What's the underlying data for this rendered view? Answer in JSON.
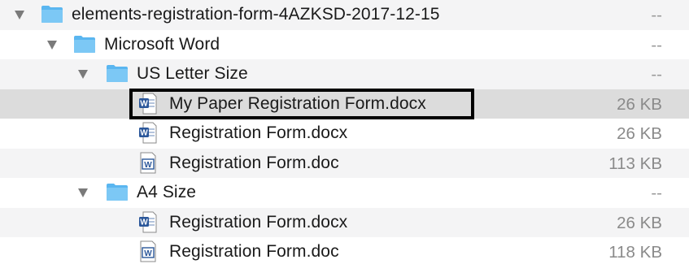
{
  "rows": [
    {
      "name": "elements-registration-form-4AZKSD-2017-12-15",
      "size": "--",
      "type": "folder"
    },
    {
      "name": "Microsoft Word",
      "size": "--",
      "type": "folder"
    },
    {
      "name": "US Letter Size",
      "size": "--",
      "type": "folder"
    },
    {
      "name": "My Paper Registration Form.docx",
      "size": "26 KB",
      "type": "docx",
      "selected": true
    },
    {
      "name": "Registration Form.docx",
      "size": "26 KB",
      "type": "docx"
    },
    {
      "name": "Registration Form.doc",
      "size": "113 KB",
      "type": "doc"
    },
    {
      "name": "A4 Size",
      "size": "--",
      "type": "folder"
    },
    {
      "name": "Registration Form.docx",
      "size": "26 KB",
      "type": "docx"
    },
    {
      "name": "Registration Form.doc",
      "size": "118 KB",
      "type": "doc"
    }
  ],
  "colors": {
    "folder": "#5ab6f0",
    "folder_tab": "#7cc8f5",
    "word_blue": "#2b579a",
    "selected_row": "#dcdcdc",
    "alt_row": "#f4f4f5"
  }
}
